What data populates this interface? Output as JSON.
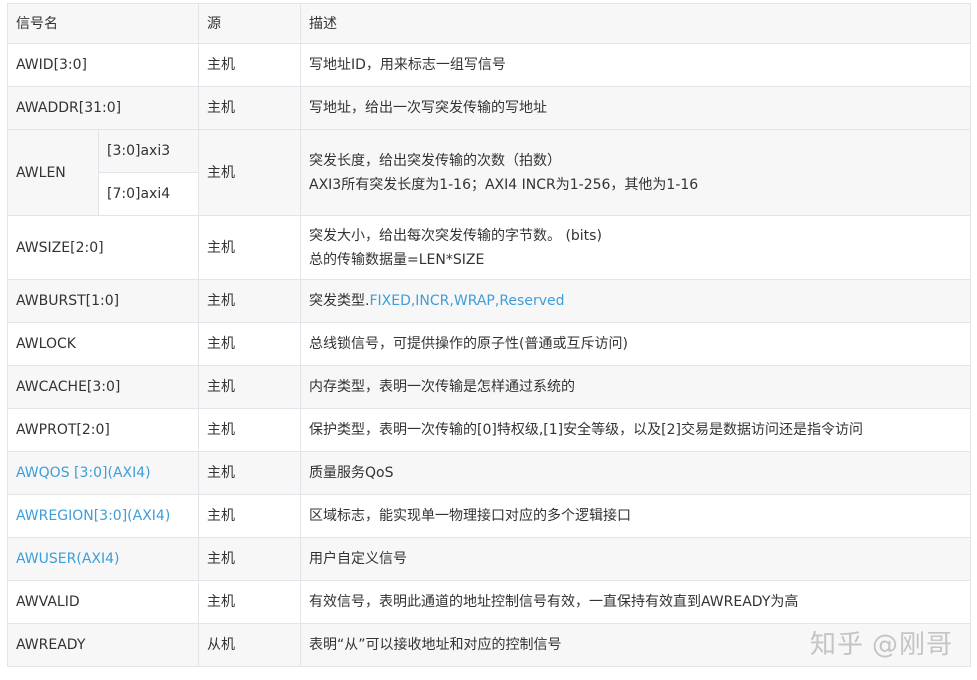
{
  "headers": {
    "signal": "信号名",
    "source": "源",
    "desc": "描述"
  },
  "rows": [
    {
      "name": "AWID[3:0]",
      "source": "主机",
      "desc": "写地址ID，用来标志一组写信号"
    },
    {
      "name": "AWADDR[31:0]",
      "source": "主机",
      "desc": "写地址，给出一次写突发传输的写地址"
    },
    {
      "name": "AWLEN",
      "sub1": "[3:0]axi3",
      "sub2": "[7:0]axi4",
      "source": "主机",
      "desc1": "突发长度，给出突发传输的次数（拍数）",
      "desc2": "AXI3所有突发长度为1-16；AXI4 INCR为1-256，其他为1-16"
    },
    {
      "name": "AWSIZE[2:0]",
      "source": "主机",
      "desc1": "突发大小，给出每次突发传输的字节数。 (bits)",
      "desc2": "总的传输数据量=LEN*SIZE"
    },
    {
      "name": "AWBURST[1:0]",
      "source": "主机",
      "desc_prefix": "突发类型.",
      "desc_colored": "FIXED,INCR,WRAP,Reserved"
    },
    {
      "name": "AWLOCK",
      "source": "主机",
      "desc": "总线锁信号，可提供操作的原子性(普通或互斥访问)"
    },
    {
      "name": "AWCACHE[3:0]",
      "source": "主机",
      "desc": "内存类型，表明一次传输是怎样通过系统的"
    },
    {
      "name": "AWPROT[2:0]",
      "source": "主机",
      "desc": "保护类型，表明一次传输的[0]特权级,[1]安全等级，以及[2]交易是数据访问还是指令访问"
    },
    {
      "name": "AWQOS [3:0](AXI4)",
      "source": "主机",
      "desc": "质量服务QoS"
    },
    {
      "name": "AWREGION[3:0](AXI4)",
      "source": "主机",
      "desc": "区域标志，能实现单一物理接口对应的多个逻辑接口"
    },
    {
      "name": "AWUSER(AXI4)",
      "source": "主机",
      "desc": "用户自定义信号"
    },
    {
      "name": "AWVALID",
      "source": "主机",
      "desc": "有效信号，表明此通道的地址控制信号有效，一直保持有效直到AWREADY为高"
    },
    {
      "name": "AWREADY",
      "source": "从机",
      "desc": "表明“从”可以接收地址和对应的控制信号"
    }
  ],
  "colors": {
    "link_blue": "#3d9ed8",
    "stripe": "#f7f7f7",
    "border": "#e1e4e8"
  },
  "watermark": {
    "brand": "知乎",
    "author": "@刚哥"
  }
}
